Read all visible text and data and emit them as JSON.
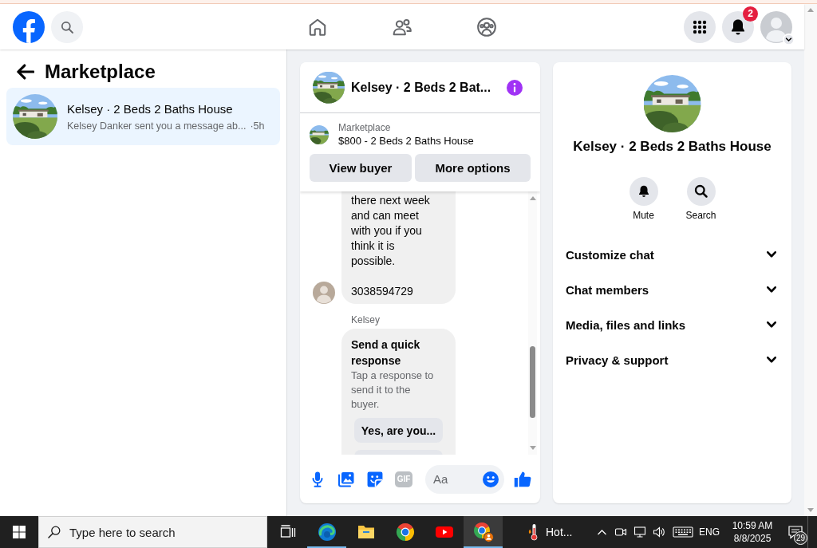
{
  "top_bar": {
    "nav": [
      {
        "kind": "home"
      },
      {
        "kind": "friends"
      },
      {
        "kind": "groups"
      }
    ],
    "notification_count": "2"
  },
  "sidebar": {
    "title": "Marketplace",
    "conversations": [
      {
        "title": "Kelsey · 2 Beds 2 Baths House",
        "snippet": "Kelsey Danker sent you a message ab...",
        "time": "·5h",
        "selected": true
      }
    ]
  },
  "chat": {
    "title": "Kelsey · 2 Beds 2 Bat...",
    "listing": {
      "label": "Marketplace",
      "title": "$800 - 2 Beds 2 Baths House"
    },
    "buttons": [
      "View buyer",
      "More options"
    ],
    "messages": [
      {
        "kind": "text",
        "text": "there next week\nand can meet\nwith you if you\nthink it is\npossible.\n\n3038594729"
      },
      {
        "kind": "quick_response",
        "sender": "Kelsey",
        "title": "Send a quick response",
        "subtitle": "Tap a response to send it to the buyer.",
        "options": [
          "Yes, are you..."
        ],
        "more_options_below": true
      }
    ],
    "composer": {
      "tools": [
        {
          "kind": "mic"
        },
        {
          "kind": "photo"
        },
        {
          "kind": "sticker"
        },
        {
          "kind": "gif",
          "label": "GIF"
        }
      ],
      "placeholder": "Aa"
    }
  },
  "details": {
    "title": "Kelsey · 2 Beds 2 Baths House",
    "actions": [
      {
        "kind": "mute",
        "label": "Mute"
      },
      {
        "kind": "search",
        "label": "Search"
      }
    ],
    "sections": [
      {
        "label": "Customize chat",
        "expanded": false
      },
      {
        "label": "Chat members",
        "expanded": false
      },
      {
        "label": "Media, files and links",
        "expanded": false
      },
      {
        "label": "Privacy & support",
        "expanded": false
      }
    ]
  },
  "taskbar": {
    "search_placeholder": "Type here to search",
    "apps": [
      {
        "kind": "task_view",
        "running": false,
        "selected": false
      },
      {
        "kind": "edge",
        "running": true,
        "selected": false
      },
      {
        "kind": "file_explorer",
        "running": false,
        "selected": false
      },
      {
        "kind": "chrome",
        "running": false,
        "selected": false
      },
      {
        "kind": "youtube",
        "running": false,
        "selected": false
      },
      {
        "kind": "chrome_profile",
        "running": true,
        "selected": true
      }
    ],
    "weather": "Hot...",
    "language": "ENG",
    "time": "10:59 AM",
    "date": "8/8/2025",
    "notification_count": "29"
  }
}
